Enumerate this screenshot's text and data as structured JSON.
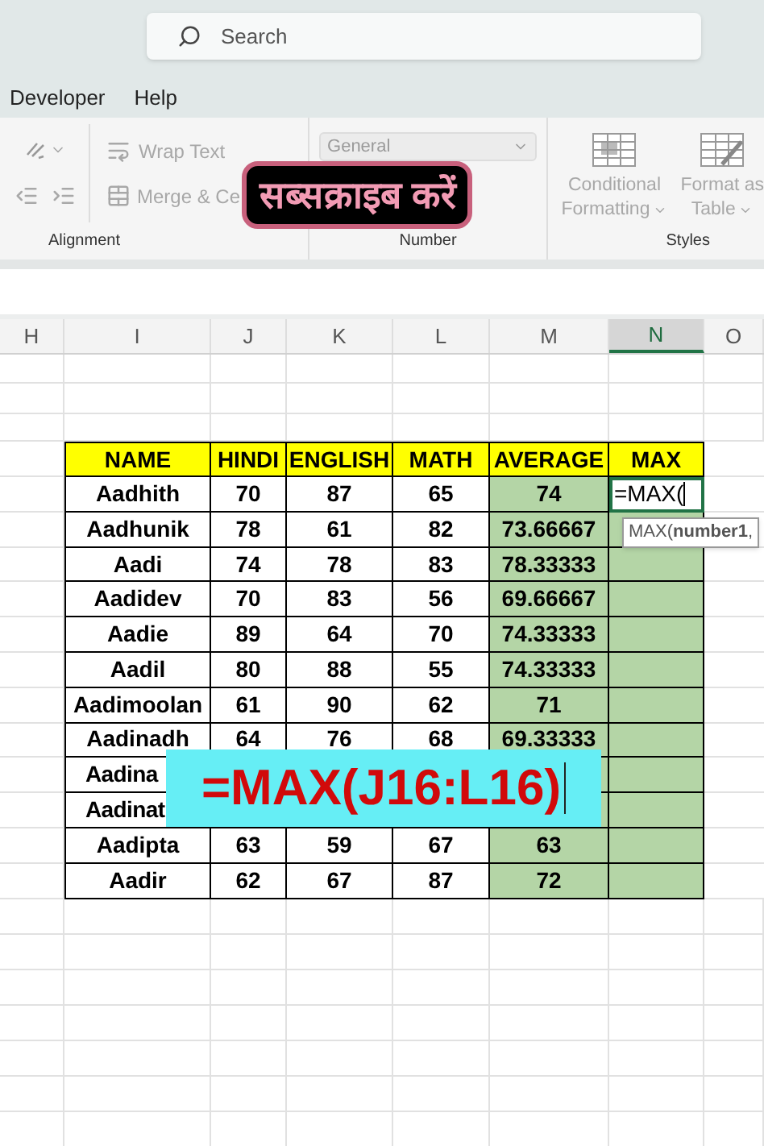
{
  "search": {
    "placeholder": "Search"
  },
  "menu": [
    {
      "label": "Developer"
    },
    {
      "label": "Help"
    }
  ],
  "ribbon": {
    "wrap_text": "Wrap Text",
    "merge": "Merge & Ce",
    "alignment_label": "Alignment",
    "number_format": "General",
    "number_label": "Number",
    "conditional": [
      "Conditional",
      "Formatting"
    ],
    "format_table": [
      "Format as",
      "Table"
    ],
    "styles_label": "Styles"
  },
  "sticker": "सब्सक्राइब करें",
  "columns": [
    {
      "label": "H",
      "selected": false
    },
    {
      "label": "I",
      "selected": false
    },
    {
      "label": "J",
      "selected": false
    },
    {
      "label": "K",
      "selected": false
    },
    {
      "label": "L",
      "selected": false
    },
    {
      "label": "M",
      "selected": false
    },
    {
      "label": "N",
      "selected": true
    },
    {
      "label": "O",
      "selected": false
    }
  ],
  "table": {
    "header": [
      "NAME",
      "HINDI",
      "ENGLISH",
      "MATH",
      "AVERAGE",
      "MAX"
    ],
    "rows": [
      {
        "name": "Aadhith",
        "cells": [
          "70",
          "87",
          "65",
          "74"
        ],
        "max": "=MAX("
      },
      {
        "name": "Aadhunik",
        "cells": [
          "78",
          "61",
          "82",
          "73.66667"
        ]
      },
      {
        "name": "Aadi",
        "cells": [
          "74",
          "78",
          "83",
          "78.33333"
        ]
      },
      {
        "name": "Aadidev",
        "cells": [
          "70",
          "83",
          "56",
          "69.66667"
        ]
      },
      {
        "name": "Aadie",
        "cells": [
          "89",
          "64",
          "70",
          "74.33333"
        ]
      },
      {
        "name": "Aadil",
        "cells": [
          "80",
          "88",
          "55",
          "74.33333"
        ]
      },
      {
        "name": "Aadimoolan",
        "cells": [
          "61",
          "90",
          "62",
          "71"
        ]
      },
      {
        "name": "Aadinadh",
        "cells": [
          "64",
          "76",
          "68",
          "69.33333"
        ]
      },
      {
        "name": "Aadina",
        "cells": []
      },
      {
        "name": "Aadinat",
        "cells": []
      },
      {
        "name": "Aadipta",
        "cells": [
          "63",
          "59",
          "67",
          "63"
        ]
      },
      {
        "name": "Aadir",
        "cells": [
          "62",
          "67",
          "87",
          "72"
        ]
      }
    ]
  },
  "tooltip": "MAX(**number1**,",
  "formula_overlay": "=MAX(J16:L16)"
}
